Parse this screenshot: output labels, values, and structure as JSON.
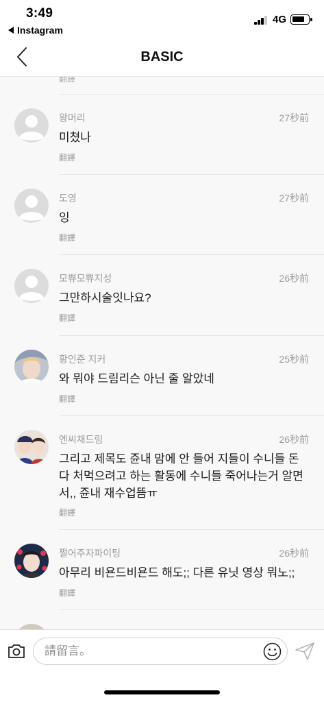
{
  "status_bar": {
    "time": "3:49",
    "back_app": "Instagram",
    "network": "4G"
  },
  "header": {
    "title": "BASIC"
  },
  "partial_top": {
    "translate": "翻譯"
  },
  "comments": [
    {
      "name": "왕머리",
      "time": "27秒前",
      "text": "미쳤나",
      "translate": "翻譯",
      "avatar": "default-avatar-icon"
    },
    {
      "name": "도영",
      "time": "27秒前",
      "text": "잉",
      "translate": "翻譯",
      "avatar": "default-avatar-icon"
    },
    {
      "name": "모쀼모쀼지성",
      "time": "26秒前",
      "text": "그만하시술잇나요?",
      "translate": "翻譯",
      "avatar": "default-avatar-icon"
    },
    {
      "name": "황인준 지커",
      "time": "25秒前",
      "text": "와 뭐야 드림리슨 아닌 줄 알았네",
      "translate": "翻譯",
      "avatar": "photo-avatar"
    },
    {
      "name": "엔씨채드림",
      "time": "26秒前",
      "text": "그리고 제목도 쥰내 맘에 안 들어 지들이 수니들 돈 다 처먹으려고 하는 활동에 수니들 죽어나는거 알면서,, 쥰내 재수업뜸ㅠ",
      "translate": "翻譯",
      "avatar": "photo-avatar"
    },
    {
      "name": "쩔어주자파이팅",
      "time": "26秒前",
      "text": "아무리 비욘드비욘드 해도;; 다른 유닛 영상 뭐노;;",
      "translate": "翻譯",
      "avatar": "photo-avatar"
    }
  ],
  "input_bar": {
    "placeholder": "請留言。",
    "camera_icon": "camera-icon",
    "emoji_icon": "emoji-icon",
    "send_icon": "send-icon"
  }
}
